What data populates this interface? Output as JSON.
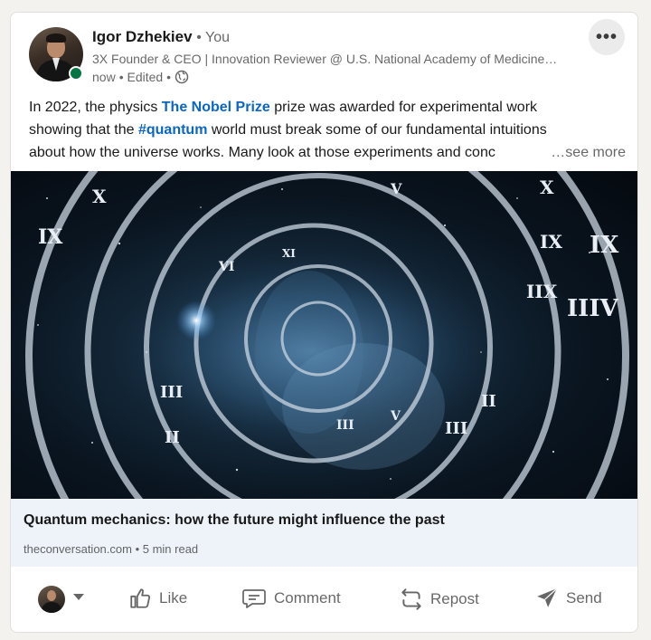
{
  "post": {
    "author": {
      "name": "Igor Dzhekiev",
      "relation": "• You",
      "headline": "3X Founder & CEO | Innovation Reviewer @ U.S. National Academy of Medicine…",
      "time": "now",
      "edited": "• Edited •",
      "visibility_icon": "globe-icon",
      "online_status_color": "#057642"
    },
    "more_icon": "•••",
    "text": {
      "l1_a": "In 2022, the physics ",
      "l1_link": "The Nobel Prize",
      "l1_b": " prize was awarded for experimental work",
      "l2_a": "showing that the ",
      "l2_tag": "#quantum",
      "l2_b": " world must break some of our fundamental intuitions",
      "l3_a": "about how the universe works. Many look at those experiments and conc",
      "see_more": "…see more"
    },
    "article": {
      "title": "Quantum mechanics: how the future might influence the past",
      "source": "theconversation.com",
      "read_time": "• 5 min read"
    },
    "actions": {
      "like": "Like",
      "comment": "Comment",
      "repost": "Repost",
      "send": "Send"
    }
  },
  "colors": {
    "link": "#0a66c2",
    "article_bg": "#edf3f8",
    "page_bg": "#f4f2ee"
  }
}
